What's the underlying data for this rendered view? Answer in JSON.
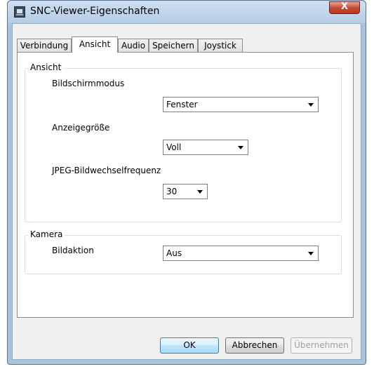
{
  "window": {
    "title": "SNC-Viewer-Eigenschaften",
    "close_glyph": "X"
  },
  "tabs": [
    {
      "label": "Verbindung"
    },
    {
      "label": "Ansicht"
    },
    {
      "label": "Audio"
    },
    {
      "label": "Speichern"
    },
    {
      "label": "Joystick"
    }
  ],
  "active_tab": "Ansicht",
  "ansicht": {
    "group_label": "Ansicht",
    "screen_mode": {
      "label": "Bildschirmmodus",
      "value": "Fenster"
    },
    "display_size": {
      "label": "Anzeigegröße",
      "value": "Voll"
    },
    "jpeg_rate": {
      "label": "JPEG-Bildwechselfrequenz",
      "value": "30"
    }
  },
  "kamera": {
    "group_label": "Kamera",
    "image_action": {
      "label": "Bildaktion",
      "value": "Aus"
    }
  },
  "buttons": {
    "ok": "OK",
    "cancel": "Abbrechen",
    "apply": "Übernehmen"
  }
}
